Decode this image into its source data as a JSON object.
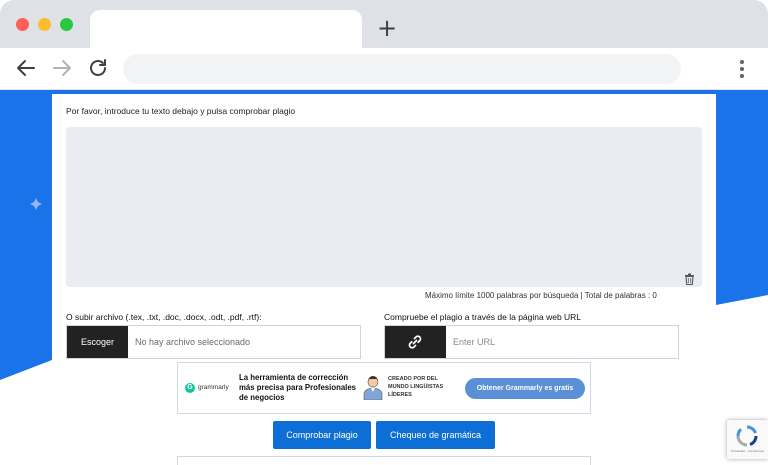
{
  "browser": {
    "new_tab_symbol": "+",
    "icons": [
      "back-arrow-icon",
      "forward-arrow-icon",
      "reload-icon",
      "kebab-menu-icon"
    ]
  },
  "form": {
    "instruction": "Por favor, introduce tu texto debajo y pulsa comprobar plagio",
    "limit_text": "Máximo límite 1000 palabras por búsqueda |  Total de palabras : 0",
    "file_label": "O subir archivo (.tex, .txt, .doc, .docx, .odt, .pdf, .rtf):",
    "choose_button": "Escoger",
    "file_status": "No hay archivo seleccionado",
    "url_label": "Compruebe el plagio a través de la página web URL",
    "url_placeholder": "Enter URL",
    "check_button": "Comprobar plagio",
    "grammar_button": "Chequeo de gramática"
  },
  "ad": {
    "brand": "grammarly",
    "headline": "La herramienta de corrección más precisa para Profesionales de negocios",
    "creator": "CREADO POR DEL MUNDO LINGÜISTAS LÍDERES",
    "cta": "Obtener Grammarly es gratis"
  },
  "recaptcha": {
    "text": "Privacidad - Condiciones"
  },
  "colors": {
    "page_blue": "#1a73e8",
    "button_blue": "#0d6fd6",
    "dark_button": "#222222",
    "textarea_bg": "#e9edf3"
  }
}
